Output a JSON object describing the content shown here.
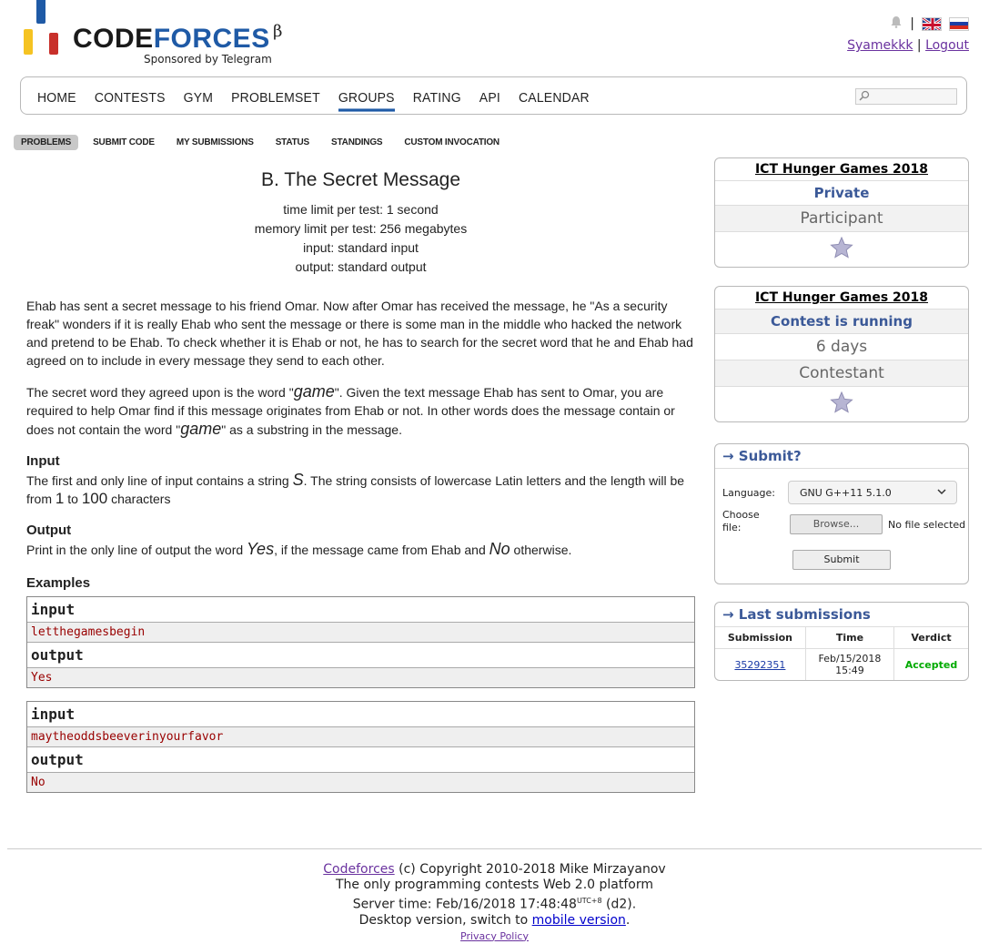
{
  "header": {
    "logo_prefix": "CODE",
    "logo_suffix": "FORCES",
    "beta": "β",
    "sponsor": "Sponsored by Telegram",
    "separator": "|",
    "user": "Syamekkk",
    "link_separator": "|",
    "logout": "Logout",
    "colors": {
      "brand_blue": "#1f5aa6",
      "bar_yellow": "#f5c322",
      "bar_blue": "#1f5aa6",
      "bar_red": "#c8302a"
    }
  },
  "menu": {
    "items": [
      "HOME",
      "CONTESTS",
      "GYM",
      "PROBLEMSET",
      "GROUPS",
      "RATING",
      "API",
      "CALENDAR"
    ],
    "active": "GROUPS",
    "search_icon": "magnifier-icon"
  },
  "submenu": {
    "items": [
      "PROBLEMS",
      "SUBMIT CODE",
      "MY SUBMISSIONS",
      "STATUS",
      "STANDINGS",
      "CUSTOM INVOCATION"
    ],
    "active": "PROBLEMS"
  },
  "problem": {
    "title": "B. The Secret Message",
    "time_limit": "time limit per test: 1 second",
    "memory_limit": "memory limit per test: 256 megabytes",
    "input": "input: standard input",
    "output": "output: standard output",
    "legend_p1": "Ehab has sent a secret message to his friend Omar. Now after Omar has received the message, he \"As a security freak\" wonders if it is really Ehab who sent the message or there is some man in the middle who hacked the network and pretend to be Ehab. To check whether it is Ehab or not, he has to search for the secret word that he and Ehab had agreed on to include in every message they send to each other.",
    "legend_p2_a": "The secret word they agreed upon is the word \"",
    "word": "game",
    "legend_p2_b": "\". Given the text message Ehab has sent to Omar, you are required to help Omar find if this message originates from Ehab or not. In other words does the message contain or does not contain the word \"",
    "legend_p2_c": "\" as a substring in the message.",
    "input_title": "Input",
    "input_a": "The first and only line of input contains a string ",
    "var_s": "S",
    "input_b": ". The string consists of lowercase Latin letters and the length will be from ",
    "num_1": "1",
    "input_to": " to ",
    "num_100": "100",
    "input_c": " characters",
    "output_title": "Output",
    "output_a": "Print in the only line of output the word ",
    "yes": "Yes",
    "output_b": ", if the message came from Ehab and ",
    "no": "No",
    "output_c": " otherwise.",
    "examples_title": "Examples",
    "examples": [
      {
        "input_label": "input",
        "input": "letthegamesbegin",
        "output_label": "output",
        "output": "Yes"
      },
      {
        "input_label": "input",
        "input": "maytheoddsbeeverinyourfavor",
        "output_label": "output",
        "output": "No"
      }
    ]
  },
  "sidebar": {
    "box1": {
      "title": "ICT Hunger Games 2018",
      "type": "Private",
      "role": "Participant"
    },
    "box2": {
      "title": "ICT Hunger Games 2018",
      "status": "Contest is running",
      "remaining": "6 days",
      "role": "Contestant"
    },
    "submit": {
      "caption": "→ Submit?",
      "language_label": "Language:",
      "language_value": "GNU G++11 5.1.0",
      "file_label": "Choose file:",
      "browse": "Browse...",
      "no_file": "No file selected",
      "submit": "Submit"
    },
    "last": {
      "caption": "→ Last submissions",
      "headers": [
        "Submission",
        "Time",
        "Verdict"
      ],
      "rows": [
        {
          "id": "35292351",
          "time_date": "Feb/15/2018",
          "time_clock": "15:49",
          "verdict": "Accepted"
        }
      ]
    }
  },
  "footer": {
    "brand": "Codeforces",
    "copyright": " (c) Copyright 2010-2018 Mike Mirzayanov",
    "tagline": "The only programming contests Web 2.0 platform",
    "server_time": "Server time: Feb/16/2018 17:48:48",
    "utc": "UTC+8",
    "d2": " (d2).",
    "desktop": "Desktop version, switch to ",
    "mobile": "mobile version",
    "period": ".",
    "privacy": "Privacy Policy"
  }
}
